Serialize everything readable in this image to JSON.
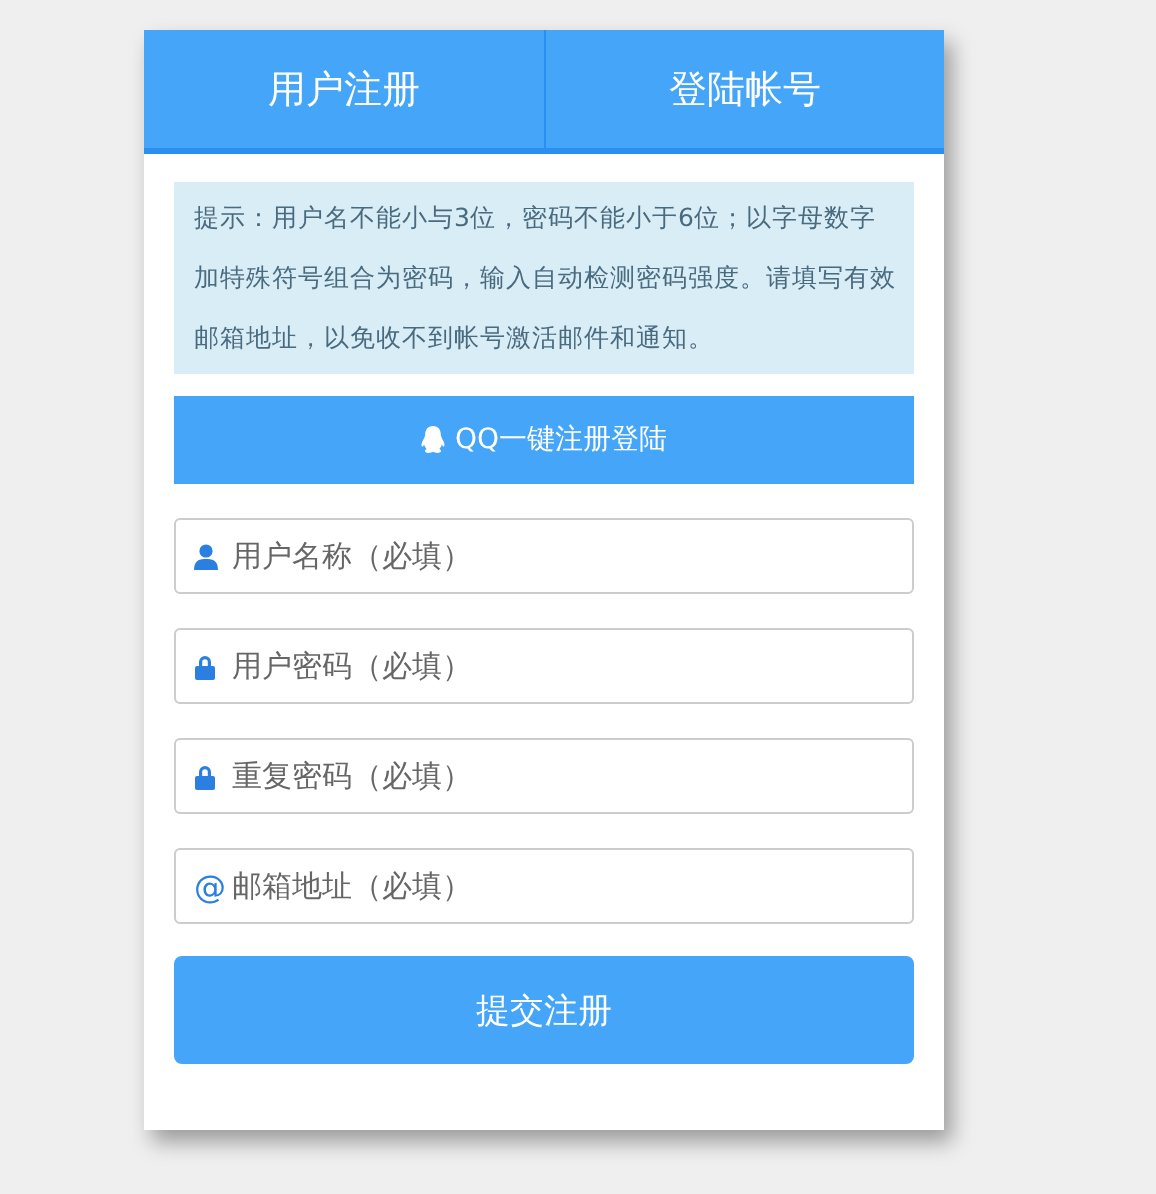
{
  "tabs": [
    {
      "label": "用户注册"
    },
    {
      "label": "登陆帐号"
    }
  ],
  "notice": "提示：用户名不能小与3位，密码不能小于6位；以字母数字加特殊符号组合为密码，输入自动检测密码强度。请填写有效邮箱地址，以免收不到帐号激活邮件和通知。",
  "qq_button": "QQ一键注册登陆",
  "fields": [
    {
      "kind": "user",
      "placeholder": "用户名称（必填）"
    },
    {
      "kind": "lock",
      "placeholder": "用户密码（必填）"
    },
    {
      "kind": "lock",
      "placeholder": "重复密码（必填）"
    },
    {
      "kind": "at",
      "icon": "@",
      "placeholder": "邮箱地址（必填）"
    }
  ],
  "submit_button": "提交注册"
}
